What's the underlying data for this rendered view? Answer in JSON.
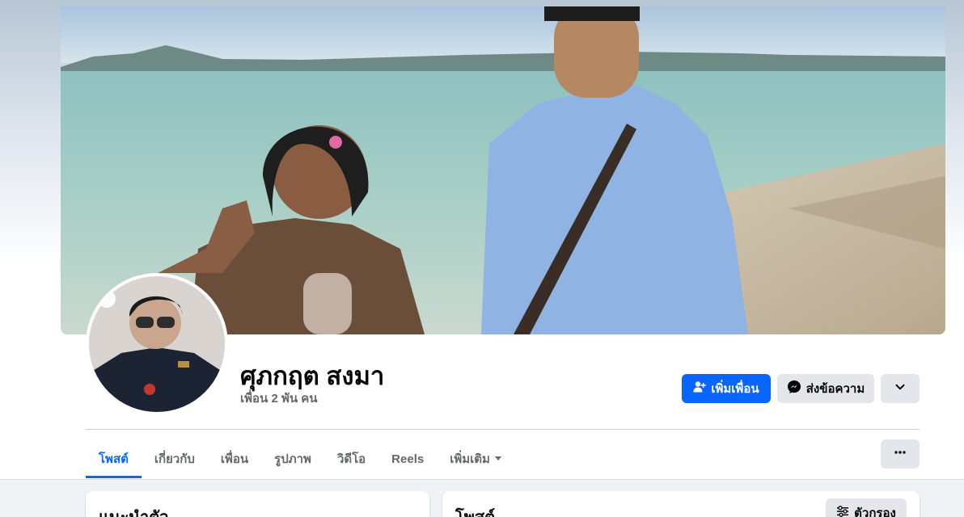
{
  "profile": {
    "name": "ศุภกฤต สงมา",
    "friends_count": "เพื่อน 2 พัน คน"
  },
  "actions": {
    "add_friend": "เพิ่มเพื่อน",
    "message": "ส่งข้อความ"
  },
  "tabs": [
    {
      "label": "โพสต์",
      "active": true
    },
    {
      "label": "เกี่ยวกับ",
      "active": false
    },
    {
      "label": "เพื่อน",
      "active": false
    },
    {
      "label": "รูปภาพ",
      "active": false
    },
    {
      "label": "วิดีโอ",
      "active": false
    },
    {
      "label": "Reels",
      "active": false
    },
    {
      "label": "เพิ่มเติม",
      "active": false
    }
  ],
  "intro": {
    "title": "แนะนำตัว"
  },
  "posts": {
    "title": "โพสต์",
    "filter_label": "ตัวกรอง"
  },
  "colors": {
    "accent": "#0866ff",
    "secondary_button": "#e4e6eb",
    "muted_text": "#65676b",
    "page_background": "#f0f2f5"
  },
  "icons": {
    "add_friend": "person-add-icon",
    "message": "messenger-icon",
    "dropdown": "chevron-down-icon",
    "more": "ellipsis-icon",
    "tab_more": "caret-down-icon",
    "filter": "sliders-icon"
  }
}
